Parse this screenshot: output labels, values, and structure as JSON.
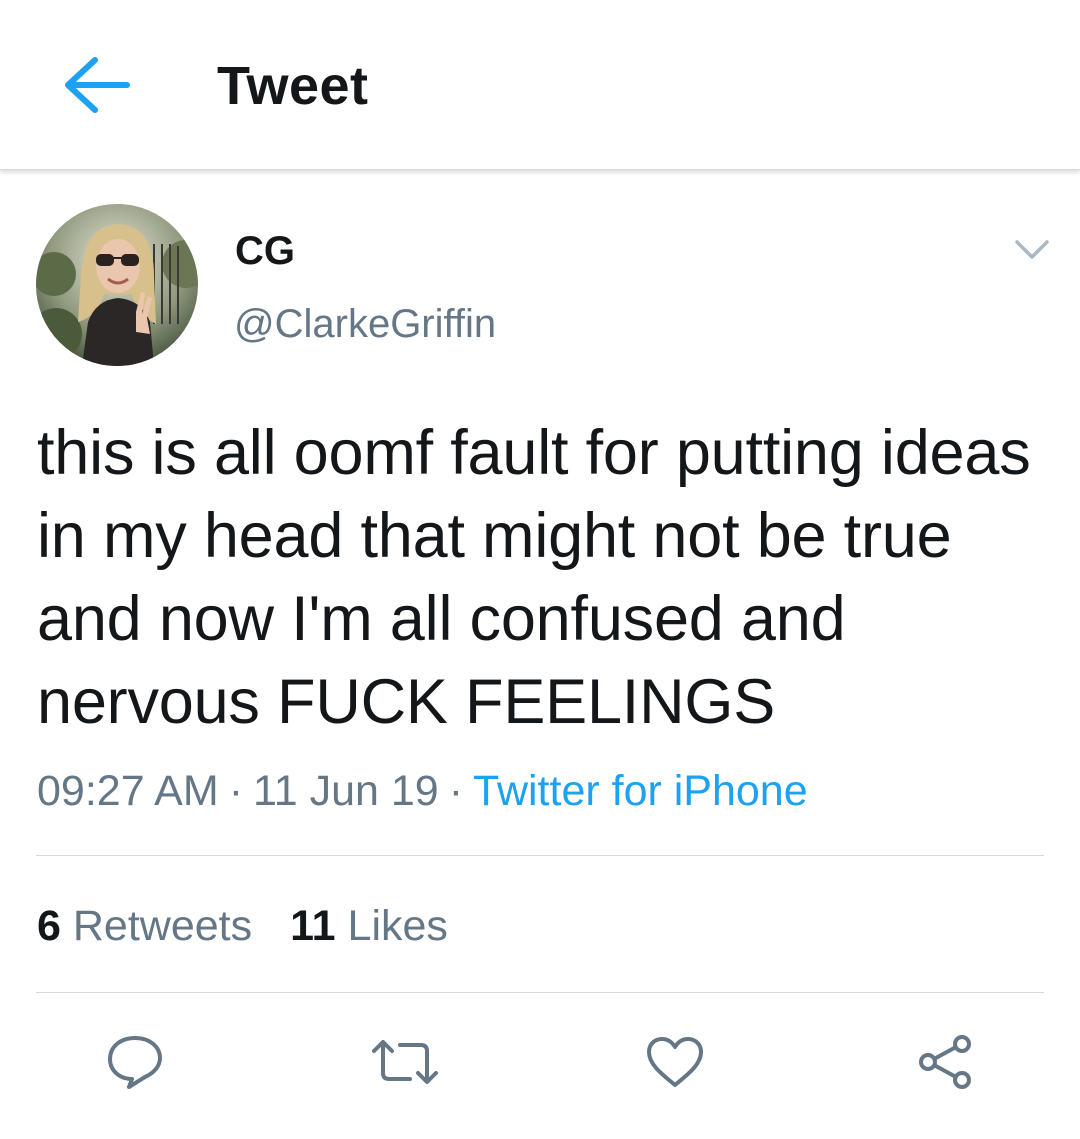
{
  "header": {
    "back_icon": "arrow-left-icon",
    "title": "Tweet"
  },
  "author": {
    "display_name": "CG",
    "handle": "@ClarkeGriffin",
    "avatar_icon": "profile-photo"
  },
  "tweet": {
    "text": "this is all oomf fault for putting ideas in my head that might not be true and now I'm all confused and nervous FUCK FEELINGS",
    "time": "09:27 AM",
    "date": "11 Jun 19",
    "separator": "·",
    "source": "Twitter for iPhone"
  },
  "stats": {
    "retweets_count": "6",
    "retweets_label": "Retweets",
    "likes_count": "11",
    "likes_label": "Likes"
  },
  "actions": [
    "reply-icon",
    "retweet-icon",
    "like-icon",
    "share-icon"
  ],
  "colors": {
    "accent": "#1da1f2",
    "text": "#14171a",
    "secondary": "#657786",
    "divider": "#d6d9db"
  }
}
